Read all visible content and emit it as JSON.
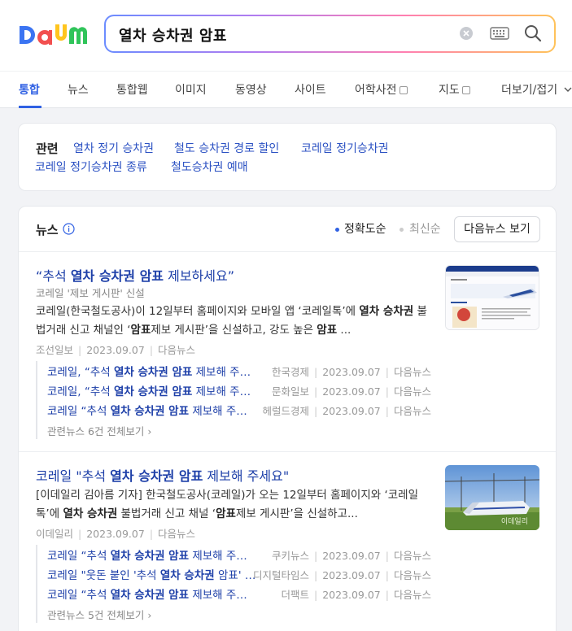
{
  "header": {
    "logo": "Daum",
    "search_value": "열차 승차권 암표"
  },
  "tabs": [
    {
      "label": "통합",
      "active": true
    },
    {
      "label": "뉴스"
    },
    {
      "label": "통합웹"
    },
    {
      "label": "이미지"
    },
    {
      "label": "동영상"
    },
    {
      "label": "사이트"
    },
    {
      "label": "어학사전"
    },
    {
      "label": "지도"
    },
    {
      "label": "더보기/접기"
    }
  ],
  "related": {
    "label": "관련",
    "links": [
      "열차 정기 승차권",
      "철도 승차권 경로 할인",
      "코레일 정기승차권",
      "코레일 정기승차권 종류",
      "철도승차권 예매"
    ]
  },
  "news": {
    "title": "뉴스",
    "sort_accuracy": "정확도순",
    "sort_recent": "최신순",
    "more_button": "다음뉴스 보기",
    "articles": [
      {
        "title_pre": "“추석 ",
        "title_bold": "열차 승차권 암표",
        "title_post": " 제보하세요”",
        "subtitle": "코레일 '제보 게시판' 신설",
        "body_html": "코레일(한국철도공사)이 12일부터 홈페이지와 모바일 앱 ‘코레일톡’에 <b>열차 승차권</b> 불법거래 신고 채널인 ‘<b>암표</b>제보 게시판’을 신설하고, 강도 높은 <b>암표</b> ...",
        "source": "조선일보",
        "date": "2023.09.07",
        "via": "다음뉴스",
        "related": [
          {
            "pre": "코레일, “추석 ",
            "bold": "열차 승차권 암표",
            "post": " 제보해 주세요”",
            "source": "한국경제",
            "date": "2023.09.07",
            "via": "다음뉴스"
          },
          {
            "pre": "코레일, “추석 ",
            "bold": "열차 승차권 암표",
            "post": " 제보해 주세요”",
            "source": "문화일보",
            "date": "2023.09.07",
            "via": "다음뉴스"
          },
          {
            "pre": "코레일 “추석 ",
            "bold": "열차 승차권 암표",
            "post": " 제보해 주세요”",
            "source": "헤럴드경제",
            "date": "2023.09.07",
            "via": "다음뉴스"
          }
        ],
        "related_all": "관련뉴스 6건 전체보기"
      },
      {
        "title_pre": "코레일 \"추석 ",
        "title_bold": "열차 승차권 암표",
        "title_post": " 제보해 주세요\"",
        "body_html": "[이데일리 김아름 기자] 한국철도공사(코레일)가 오는 12일부터 홈페이지와 ‘코레일톡’에 <b>열차 승차권</b> 불법거래 신고 채널 ‘<b>암표</b>제보 게시판’을 신설하고...",
        "source": "이데일리",
        "date": "2023.09.07",
        "via": "다음뉴스",
        "thumb_caption": "이데일리",
        "related": [
          {
            "pre": "코레일 “추석 ",
            "bold": "열차 승차권 암표",
            "post": " 제보해 주세요”",
            "source": "쿠키뉴스",
            "date": "2023.09.07",
            "via": "다음뉴스"
          },
          {
            "pre": "코레일 \"웃돈 붙인 '추석 ",
            "bold": "열차 승차권",
            "post": " 암표' 제보해 주세요\"",
            "source": "디지털타임스",
            "date": "2023.09.07",
            "via": "다음뉴스"
          },
          {
            "pre": "코레일 “추석 ",
            "bold": "열차 승차권 암표",
            "post": " 제보해 주세요”",
            "source": "더팩트",
            "date": "2023.09.07",
            "via": "다음뉴스"
          }
        ],
        "related_all": "관련뉴스 5건 전체보기"
      }
    ]
  }
}
